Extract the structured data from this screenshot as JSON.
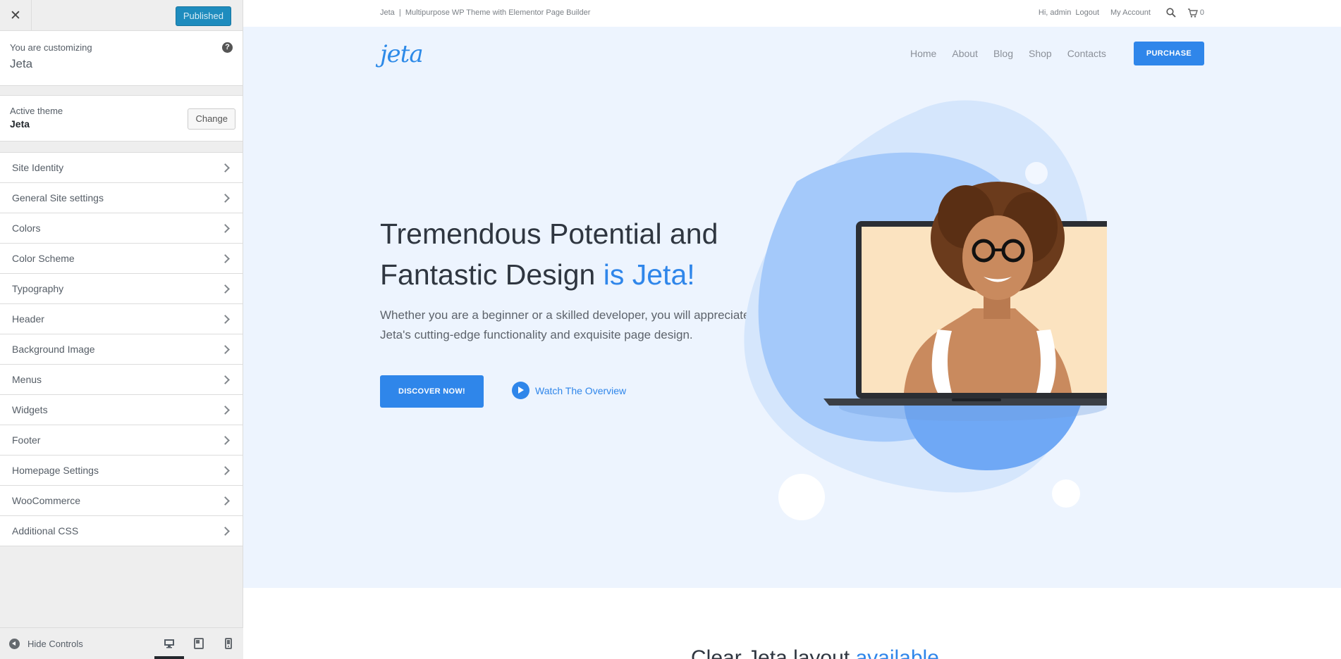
{
  "customizer": {
    "close_icon": "close-icon",
    "publish_label": "Published",
    "customizing_label": "You are customizing",
    "site_name": "Jeta",
    "help_icon": "help-icon",
    "active_theme_label": "Active theme",
    "active_theme_name": "Jeta",
    "change_label": "Change",
    "sections": [
      {
        "label": "Site Identity"
      },
      {
        "label": "General Site settings"
      },
      {
        "label": "Colors"
      },
      {
        "label": "Color Scheme"
      },
      {
        "label": "Typography"
      },
      {
        "label": "Header"
      },
      {
        "label": "Background Image"
      },
      {
        "label": "Menus"
      },
      {
        "label": "Widgets"
      },
      {
        "label": "Footer"
      },
      {
        "label": "Homepage Settings"
      },
      {
        "label": "WooCommerce"
      },
      {
        "label": "Additional CSS"
      }
    ],
    "hide_controls_label": "Hide Controls",
    "devices": [
      "desktop-icon",
      "tablet-icon",
      "mobile-icon"
    ],
    "active_device": "desktop"
  },
  "preview": {
    "topbar": {
      "tagline": "Jeta  |  Multipurpose WP Theme with Elementor Page Builder",
      "greeting": "Hi, admin",
      "logout": "Logout",
      "my_account": "My Account",
      "cart_count": "0"
    },
    "logo_text": "jeta",
    "nav": [
      "Home",
      "About",
      "Blog",
      "Shop",
      "Contacts"
    ],
    "purchase_label": "PURCHASE",
    "hero": {
      "title_line1": "Tremendous Potential and",
      "title_line2_plain": "Fantastic Design ",
      "title_line2_accent": "is Jeta!",
      "subtitle": "Whether you are a beginner or a skilled developer, you will appreciate Jeta's cutting-edge functionality and exquisite page design.",
      "discover_label": "DISCOVER NOW!",
      "watch_label": "Watch The Overview"
    },
    "next_section_title_plain": "Clear Jeta layout ",
    "next_section_title_accent": "available"
  },
  "colors": {
    "accent": "#2f86ea",
    "publish": "#1e8cbe",
    "hero_bg": "#edf4fe",
    "sidebar_bg": "#eeeeee"
  }
}
